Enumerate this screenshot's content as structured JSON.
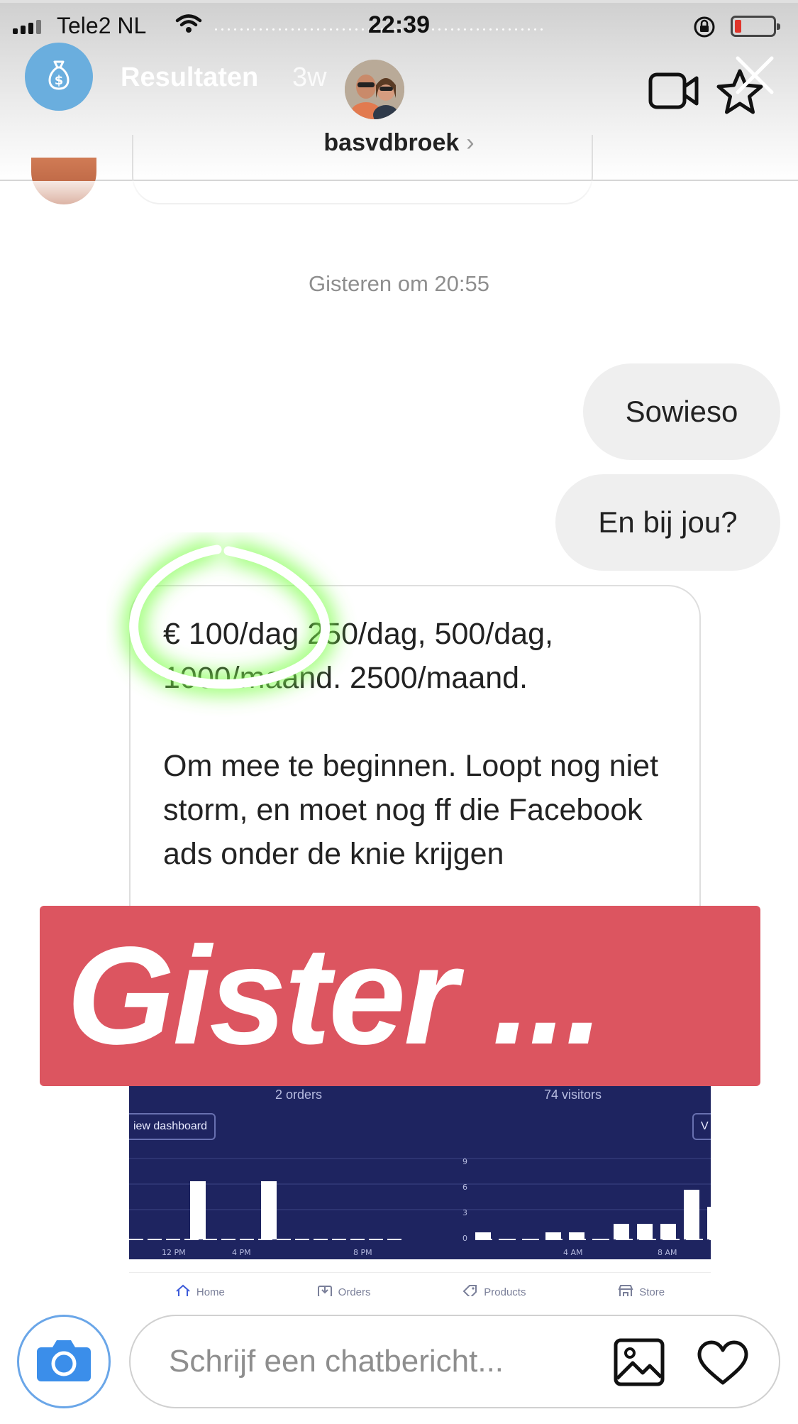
{
  "status_bar": {
    "carrier": "Tele2 NL",
    "time": "22:39",
    "battery_color": "#e0352b"
  },
  "story": {
    "title": "Resultaten",
    "age": "3w",
    "avatar_icon": "money-bag-icon",
    "avatar_color": "#6aaede"
  },
  "chat": {
    "username": "basvdbroek",
    "chevron": "›"
  },
  "messages": {
    "timestamp": "Gisteren om 20:55",
    "sent": [
      {
        "text": "Sowieso"
      },
      {
        "text": "En bij jou?"
      }
    ],
    "received": {
      "line1": "€ 100/dag 250/dag, 500/dag,",
      "line2": "1000/maand. 2500/maand.",
      "para2": "Om mee te beginnen. Loopt nog niet storm, en moet nog ff die Facebook ads onder de knie krijgen"
    }
  },
  "sticker": {
    "text": "Gister ...",
    "color": "#dc5560"
  },
  "dashboard": {
    "orders_label": "2 orders",
    "visitors_label": "74 visitors",
    "view_button": "iew dashboard",
    "right_button": "V",
    "left_ticks": [
      "12 PM",
      "4 PM",
      "8 PM"
    ],
    "right_ticks": [
      "4 AM",
      "8 AM"
    ],
    "y_ticks": [
      "9",
      "6",
      "3",
      "0"
    ],
    "tabs": [
      "Home",
      "Orders",
      "Products",
      "Store"
    ]
  },
  "composer": {
    "placeholder": "Schrijf een chatbericht..."
  }
}
